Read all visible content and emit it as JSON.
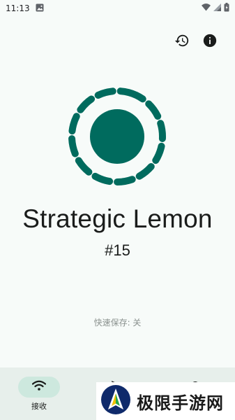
{
  "status_bar": {
    "time": "11:13"
  },
  "device": {
    "name": "Strategic Lemon",
    "number": "#15"
  },
  "quick_save": {
    "text": "快速保存: 关"
  },
  "nav": {
    "items": [
      {
        "label": "接收",
        "active": true
      },
      {
        "label": "",
        "active": false
      },
      {
        "label": "",
        "active": false
      }
    ]
  },
  "watermark": {
    "text": "极限手游网"
  },
  "colors": {
    "accent": "#006b5e",
    "background": "#f7fbf9",
    "nav_background": "#e7efeb",
    "nav_active_pill": "#cde8de"
  },
  "icons": {
    "history": "history-icon",
    "info": "info-icon",
    "receive": "wifi-icon",
    "send": "send-icon",
    "settings": "settings-icon"
  }
}
